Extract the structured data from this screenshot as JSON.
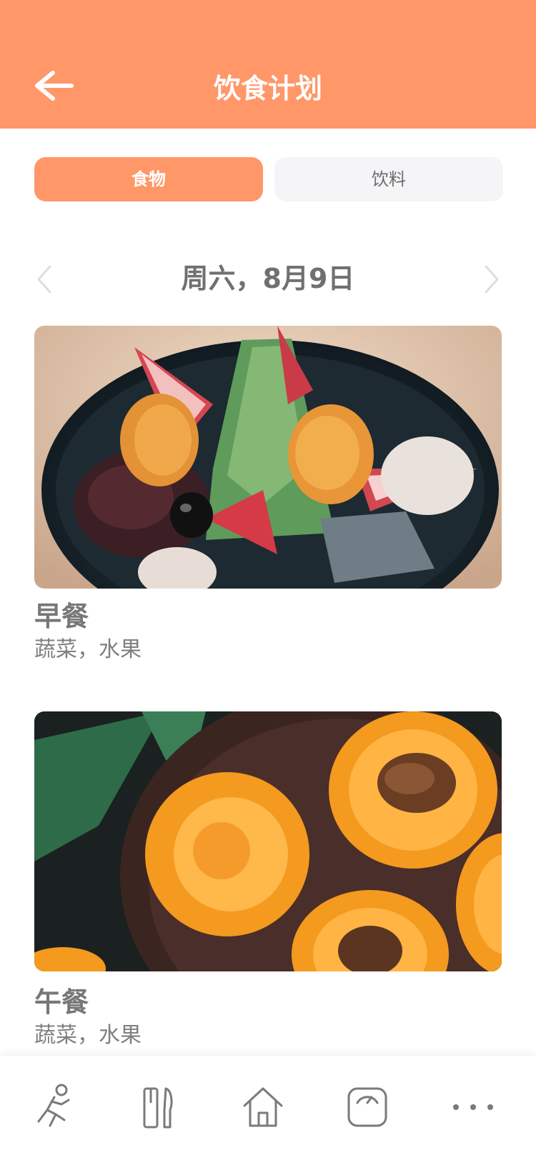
{
  "header": {
    "title": "饮食计划",
    "color": "#FF9769"
  },
  "segments": {
    "food_label": "食物",
    "drink_label": "饮料",
    "active": "food"
  },
  "date": {
    "label": "周六，8月9日"
  },
  "meals": [
    {
      "name": "早餐",
      "desc": "蔬菜，水果",
      "image": "bowl-dessert-with-strawberry-and-orange"
    },
    {
      "name": "午餐",
      "desc": "蔬菜，水果",
      "image": "apricot-halves-on-wooden-board"
    }
  ],
  "tabbar": {
    "items": [
      "run-icon",
      "utensils-icon",
      "home-icon",
      "scale-icon",
      "more-icon"
    ]
  }
}
